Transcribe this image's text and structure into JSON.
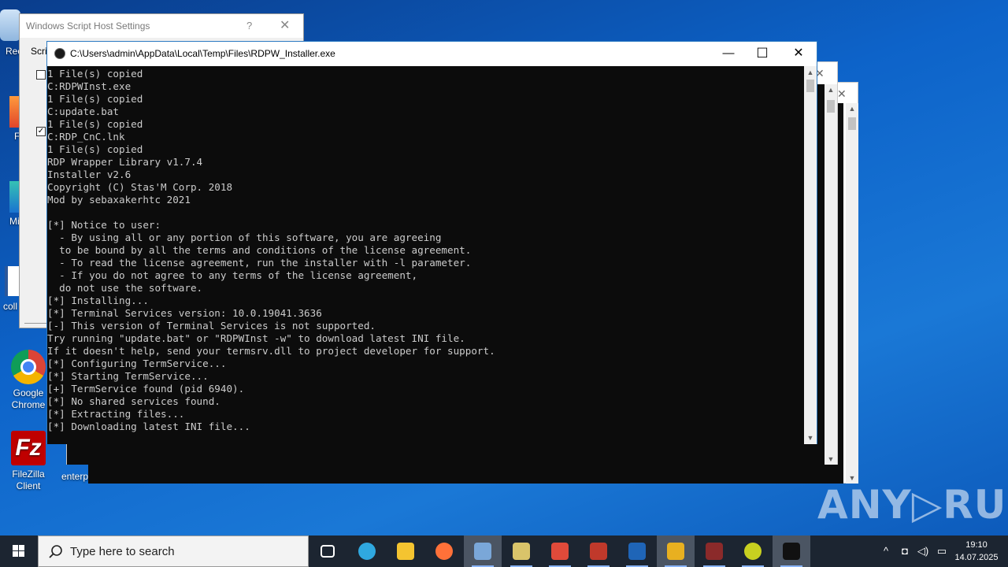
{
  "desktop": {
    "icons": [
      {
        "label": "Rec",
        "kind": "recycle"
      },
      {
        "label": "F",
        "kind": "firefox"
      },
      {
        "label": "Mi",
        "kind": "edge"
      },
      {
        "label": "coll",
        "kind": "word"
      },
      {
        "label": "Google Chrome",
        "kind": "chrome"
      },
      {
        "label": "FileZilla Client",
        "kind": "filezilla"
      },
      {
        "label": "enterp",
        "kind": "partial"
      }
    ]
  },
  "wsh_dialog": {
    "title": "Windows Script Host Settings",
    "help_glyph": "?",
    "close_glyph": "✕",
    "tab_label": "Scrip",
    "checkbox_1_checked": false,
    "checkbox_2_checked": true
  },
  "console": {
    "title": "C:\\Users\\admin\\AppData\\Local\\Temp\\Files\\RDPW_Installer.exe",
    "minimize_glyph": "—",
    "maximize_glyph": "☐",
    "close_glyph": "✕",
    "lines": [
      "1 File(s) copied",
      "C:RDPWInst.exe",
      "1 File(s) copied",
      "C:update.bat",
      "1 File(s) copied",
      "C:RDP_CnC.lnk",
      "1 File(s) copied",
      "RDP Wrapper Library v1.7.4",
      "Installer v2.6",
      "Copyright (C) Stas'M Corp. 2018",
      "Mod by sebaxakerhtc 2021",
      "",
      "[*] Notice to user:",
      "  - By using all or any portion of this software, you are agreeing",
      "  to be bound by all the terms and conditions of the license agreement.",
      "  - To read the license agreement, run the installer with -l parameter.",
      "  - If you do not agree to any terms of the license agreement,",
      "  do not use the software.",
      "[*] Installing...",
      "[*] Terminal Services version: 10.0.19041.3636",
      "[-] This version of Terminal Services is not supported.",
      "Try running \"update.bat\" or \"RDPWInst -w\" to download latest INI file.",
      "If it doesn't help, send your termsrv.dll to project developer for support.",
      "[*] Configuring TermService...",
      "[*] Starting TermService...",
      "[+] TermService found (pid 6940).",
      "[*] No shared services found.",
      "[*] Extracting files...",
      "[*] Downloading latest INI file..."
    ]
  },
  "watermark": "ANY▷RUN",
  "taskbar": {
    "search_placeholder": "Type here to search",
    "apps": [
      {
        "name": "task-view",
        "color": "#ffffff"
      },
      {
        "name": "edge",
        "color": "#2fa8e0"
      },
      {
        "name": "file-explorer",
        "color": "#f4c430"
      },
      {
        "name": "firefox",
        "color": "#ff7139"
      },
      {
        "name": "script-host",
        "color": "#7aa7d8"
      },
      {
        "name": "keys",
        "color": "#d9c46a"
      },
      {
        "name": "calendar-app",
        "color": "#e04a3a"
      },
      {
        "name": "cherry-app",
        "color": "#c0392b"
      },
      {
        "name": "r-app",
        "color": "#1f65b7"
      },
      {
        "name": "blocks-app",
        "color": "#e8b020"
      },
      {
        "name": "ida-app",
        "color": "#8b2a2a"
      },
      {
        "name": "kiwi-app",
        "color": "#c8d020"
      },
      {
        "name": "console-app",
        "color": "#111111"
      }
    ],
    "time": "19:10",
    "date": "14.07.2025"
  }
}
